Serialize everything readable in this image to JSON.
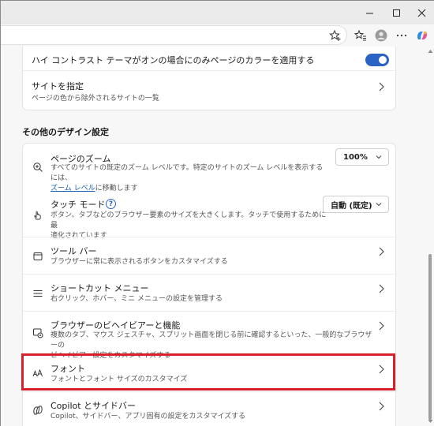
{
  "top_card": {
    "high_contrast": {
      "title": "ハイ コントラスト テーマがオンの場合にのみページのカラーを適用する",
      "enabled": true
    },
    "site_specify": {
      "title": "サイトを指定",
      "desc": "ページの色から除外されるサイトの一覧"
    }
  },
  "section_heading": "その他のデザイン設定",
  "settings": {
    "zoom": {
      "title": "ページのズーム",
      "desc_line1": "すべてのサイトの既定のズーム レベルです。特定のサイトのズーム レベルを表示するには、",
      "desc_link": "ズーム レベル",
      "desc_line2_rest": "に移動します",
      "value": "100%",
      "icon": "zoom-in-icon"
    },
    "touch": {
      "title": "タッチ モード",
      "help": "?",
      "desc_line1": "ボタン、タブなどのブラウザー要素のサイズを大きくします。タッチで使用するために最",
      "desc_line2": "適化されています",
      "value": "自動 (既定)",
      "icon": "touch-hand-icon"
    },
    "toolbar": {
      "title": "ツール バー",
      "desc": "ブラウザーに常に表示されるボタンをカスタマイズする",
      "icon": "toolbar-icon"
    },
    "shortcut_menu": {
      "title": "ショートカット メニュー",
      "desc": "右クリック、ホバー、ミニ メニューの設定を管理する",
      "icon": "menu-icon"
    },
    "browser_behavior": {
      "title": "ブラウザーのビヘイビアーと機能",
      "desc_line1": "複数のタブ、マウス ジェスチャ、スプリット画面を閉じる前に確認するといった、一般的なブラウザーの",
      "desc_line2": "ビヘイビアー設定をカスタマイズする",
      "icon": "browser-behavior-icon"
    },
    "fonts": {
      "title": "フォント",
      "desc": "フォントとフォント サイズのカスタマイズ",
      "icon": "font-icon"
    },
    "copilot": {
      "title": "Copilot とサイドバー",
      "desc": "Copilot、サイドバー、アプリ固有の設定をカスタマイズする",
      "icon": "copilot-icon"
    }
  },
  "colors": {
    "accent": "#2a63c4",
    "highlight": "#d6202a"
  }
}
